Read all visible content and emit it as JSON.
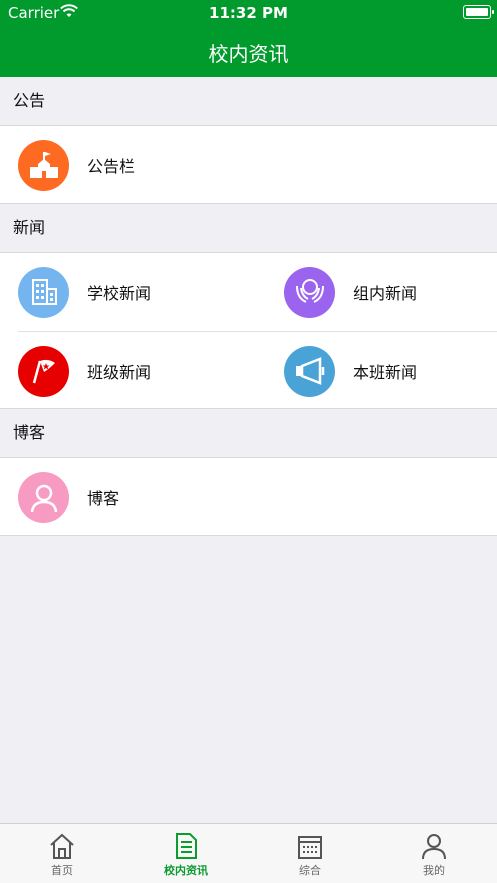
{
  "status": {
    "carrier": "Carrier",
    "time": "11:32 PM"
  },
  "header": {
    "title": "校内资讯"
  },
  "sections": {
    "announcement": {
      "label": "公告",
      "items": [
        {
          "label": "公告栏",
          "icon": "school-building-icon",
          "color": "#ff6a23"
        }
      ]
    },
    "news": {
      "label": "新闻",
      "items": [
        {
          "label": "学校新闻",
          "icon": "buildings-icon",
          "color": "#74b5ef"
        },
        {
          "label": "组内新闻",
          "icon": "group-hands-icon",
          "color": "#9b64ee"
        },
        {
          "label": "班级新闻",
          "icon": "flag-icon",
          "color": "#e60000"
        },
        {
          "label": "本班新闻",
          "icon": "megaphone-icon",
          "color": "#4aa3d7"
        }
      ]
    },
    "blog": {
      "label": "博客",
      "items": [
        {
          "label": "博客",
          "icon": "person-icon",
          "color": "#f79bc2"
        }
      ]
    }
  },
  "tabs": [
    {
      "label": "首页",
      "icon": "home-icon",
      "active": false
    },
    {
      "label": "校内资讯",
      "icon": "document-icon",
      "active": true
    },
    {
      "label": "综合",
      "icon": "calendar-icon",
      "active": false
    },
    {
      "label": "我的",
      "icon": "user-icon",
      "active": false
    }
  ]
}
